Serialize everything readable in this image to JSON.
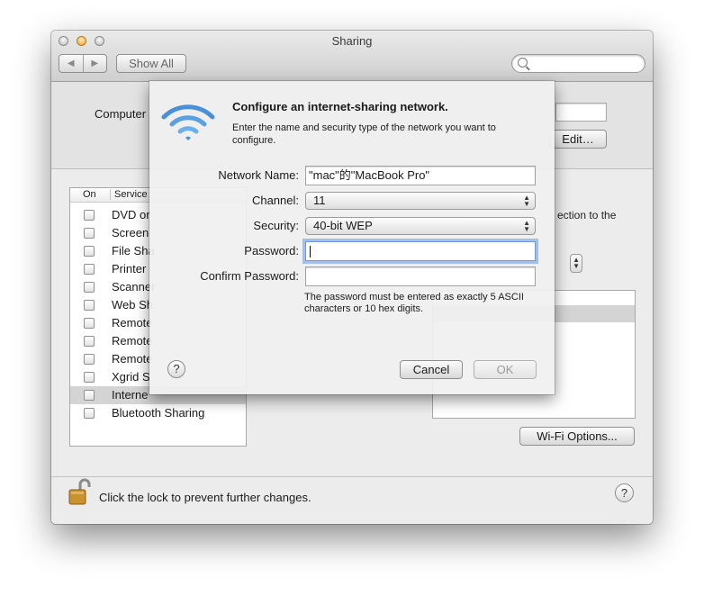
{
  "window": {
    "title": "Sharing",
    "show_all_label": "Show All",
    "search_placeholder": ""
  },
  "top": {
    "computer_name_label": "Computer",
    "edit_label": "Edit…"
  },
  "service_list": {
    "header_on": "On",
    "header_service": "Service",
    "items": [
      {
        "label": "DVD or",
        "checked": false,
        "selected": false
      },
      {
        "label": "Screen",
        "checked": false,
        "selected": false
      },
      {
        "label": "File Sha",
        "checked": false,
        "selected": false
      },
      {
        "label": "Printer",
        "checked": false,
        "selected": false
      },
      {
        "label": "Scanner",
        "checked": false,
        "selected": false
      },
      {
        "label": "Web Sh",
        "checked": false,
        "selected": false
      },
      {
        "label": "Remote",
        "checked": false,
        "selected": false
      },
      {
        "label": "Remote",
        "checked": false,
        "selected": false
      },
      {
        "label": "Remote",
        "checked": false,
        "selected": false
      },
      {
        "label": "Xgrid S",
        "checked": false,
        "selected": false
      },
      {
        "label": "Interne",
        "checked": false,
        "selected": true
      },
      {
        "label": "Bluetooth Sharing",
        "checked": false,
        "selected": false
      }
    ]
  },
  "right_pane": {
    "description_fragment": "ection to the",
    "wifi_options_label": "Wi-Fi Options..."
  },
  "bottom": {
    "lock_text": "Click the lock to prevent further changes.",
    "help_label": "?"
  },
  "sheet": {
    "title": "Configure an internet-sharing network.",
    "description": "Enter the name and security type of the network you want to configure.",
    "network_name_label": "Network Name:",
    "network_name_value": "\"mac\"的\"MacBook Pro\"",
    "channel_label": "Channel:",
    "channel_value": "11",
    "security_label": "Security:",
    "security_value": "40-bit WEP",
    "password_label": "Password:",
    "password_value": "",
    "confirm_password_label": "Confirm Password:",
    "confirm_password_value": "",
    "hint": "The password must be entered as exactly 5 ASCII characters or 10 hex digits.",
    "help_label": "?",
    "cancel_label": "Cancel",
    "ok_label": "OK"
  },
  "colors": {
    "wifi_icon": "#4a90d9",
    "focus_ring": "#7aa5e6",
    "selection_gray": "#d4d4d4"
  }
}
